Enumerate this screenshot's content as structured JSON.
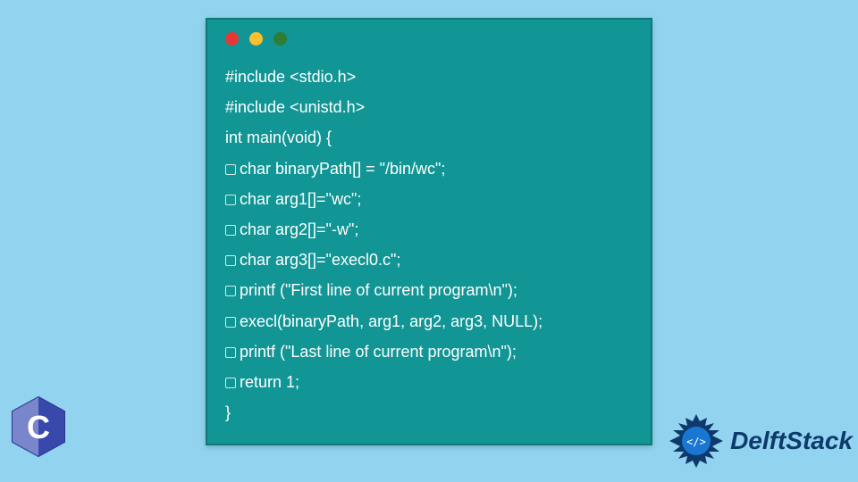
{
  "code": {
    "lines": [
      {
        "indent": false,
        "text": "#include <stdio.h>"
      },
      {
        "indent": false,
        "text": "#include <unistd.h>"
      },
      {
        "indent": false,
        "text": "int main(void) {"
      },
      {
        "indent": true,
        "text": "char binaryPath[] = \"/bin/wc\";"
      },
      {
        "indent": true,
        "text": "char arg1[]=\"wc\";"
      },
      {
        "indent": true,
        "text": "char arg2[]=\"-w\";"
      },
      {
        "indent": true,
        "text": "char arg3[]=\"execl0.c\";"
      },
      {
        "indent": true,
        "text": "printf (\"First line of current program\\n\");"
      },
      {
        "indent": true,
        "text": "execl(binaryPath, arg1, arg2, arg3, NULL);"
      },
      {
        "indent": true,
        "text": "printf (\"Last line of current program\\n\");"
      },
      {
        "indent": true,
        "text": "return 1;"
      },
      {
        "indent": false,
        "text": "}"
      }
    ]
  },
  "c_logo_letter": "C",
  "brand": "DelftStack",
  "colors": {
    "bg": "#92d3f0",
    "window": "#119595",
    "brand_text": "#0e3a6b"
  }
}
